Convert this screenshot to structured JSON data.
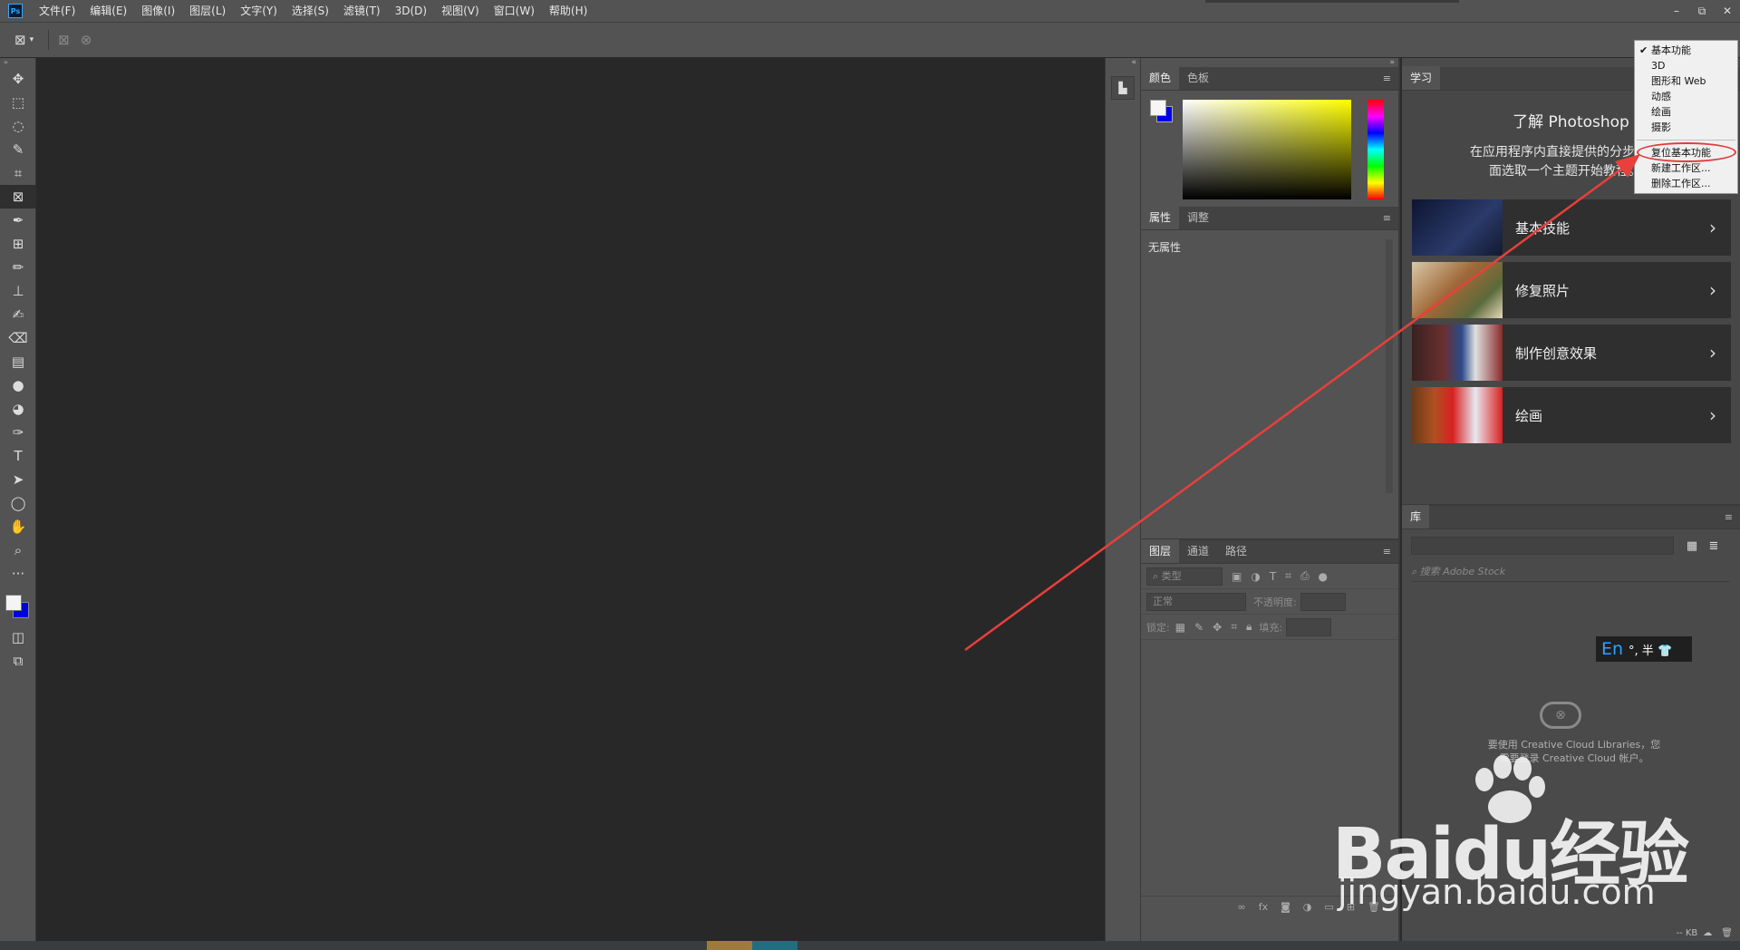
{
  "app": {
    "logo": "Ps"
  },
  "menu": [
    "文件(F)",
    "编辑(E)",
    "图像(I)",
    "图层(L)",
    "文字(Y)",
    "选择(S)",
    "滤镜(T)",
    "3D(D)",
    "视图(V)",
    "窗口(W)",
    "帮助(H)"
  ],
  "window_controls": {
    "minimize": "–",
    "restore": "⧉",
    "close": "✕"
  },
  "options_bar": {
    "tool_icon": "frame-tool-icon"
  },
  "color_panel": {
    "tabs": [
      "颜色",
      "色板"
    ],
    "foreground": "#f6f6f6",
    "background": "#0000e8"
  },
  "properties_panel": {
    "tabs": [
      "属性",
      "调整"
    ],
    "empty_text": "无属性"
  },
  "layers_panel": {
    "tabs": [
      "图层",
      "通道",
      "路径"
    ],
    "filter_placeholder": "类型",
    "blend_mode": "正常",
    "opacity_label": "不透明度:",
    "lock_label": "锁定:",
    "fill_label": "填充:"
  },
  "learn_panel": {
    "tab": "学习",
    "title": "了解 Photoshop",
    "description_line1": "在应用程序内直接提供的分步指导",
    "description_line2": "面选取一个主题开始教程。",
    "cards": [
      {
        "label": "基本技能",
        "thumb_color": "#1e2a4a"
      },
      {
        "label": "修复照片",
        "thumb_color": "#8a6a4a"
      },
      {
        "label": "制作创意效果",
        "thumb_color": "#3a2a2a"
      },
      {
        "label": "绘画",
        "thumb_color": "#c2201e"
      }
    ],
    "chevron": "›"
  },
  "library_panel": {
    "tab": "库",
    "search_placeholder": "搜索 Adobe Stock",
    "message_line1": "要使用 Creative Cloud Libraries，您",
    "message_line2": "需要登录 Creative Cloud 帐户。",
    "footer": "-- KB"
  },
  "ime": {
    "mode": "En",
    "rest": "°, 半 👕"
  },
  "workspace_menu": {
    "items": [
      "基本功能",
      "3D",
      "图形和 Web",
      "动感",
      "绘画",
      "摄影"
    ],
    "checked": "基本功能",
    "actions": [
      "复位基本功能",
      "新建工作区...",
      "删除工作区..."
    ],
    "check_mark": "✔"
  },
  "watermark": {
    "main": "Baidu经验",
    "sub": "jingyan.baidu.com"
  }
}
